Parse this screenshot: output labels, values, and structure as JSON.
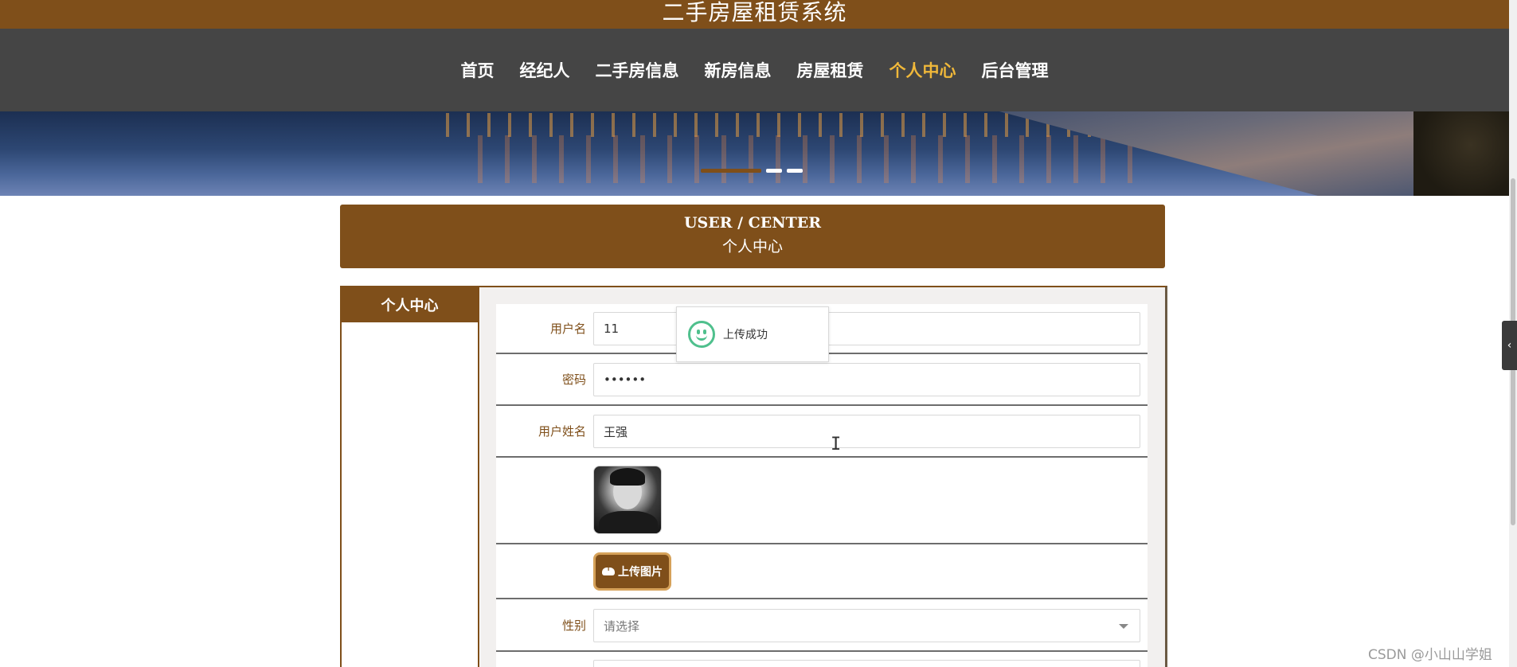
{
  "site": {
    "title": "二手房屋租赁系统"
  },
  "nav": {
    "items": [
      {
        "label": "首页"
      },
      {
        "label": "经纪人"
      },
      {
        "label": "二手房信息"
      },
      {
        "label": "新房信息"
      },
      {
        "label": "房屋租赁"
      },
      {
        "label": "个人中心",
        "active": true
      },
      {
        "label": "后台管理"
      }
    ],
    "active_color": "#f0b83a"
  },
  "colors": {
    "brand": "#7f4f1a",
    "nav_bg": "#454545",
    "success": "#4fc08d"
  },
  "section": {
    "title_en": "USER / CENTER",
    "title_cn": "个人中心"
  },
  "sidebar": {
    "active_item": "个人中心"
  },
  "form": {
    "username": {
      "label": "用户名",
      "value": "11"
    },
    "password": {
      "label": "密码",
      "value": "••••••"
    },
    "realname": {
      "label": "用户姓名",
      "value": "王强"
    },
    "avatar": {
      "icon": "user-photo"
    },
    "upload": {
      "label": "上传图片",
      "icon": "cloud-upload-icon"
    },
    "gender": {
      "label": "性别",
      "placeholder": "请选择"
    }
  },
  "toast": {
    "message": "上传成功",
    "icon": "smile-icon"
  },
  "watermark": "CSDN @小山山学姐"
}
